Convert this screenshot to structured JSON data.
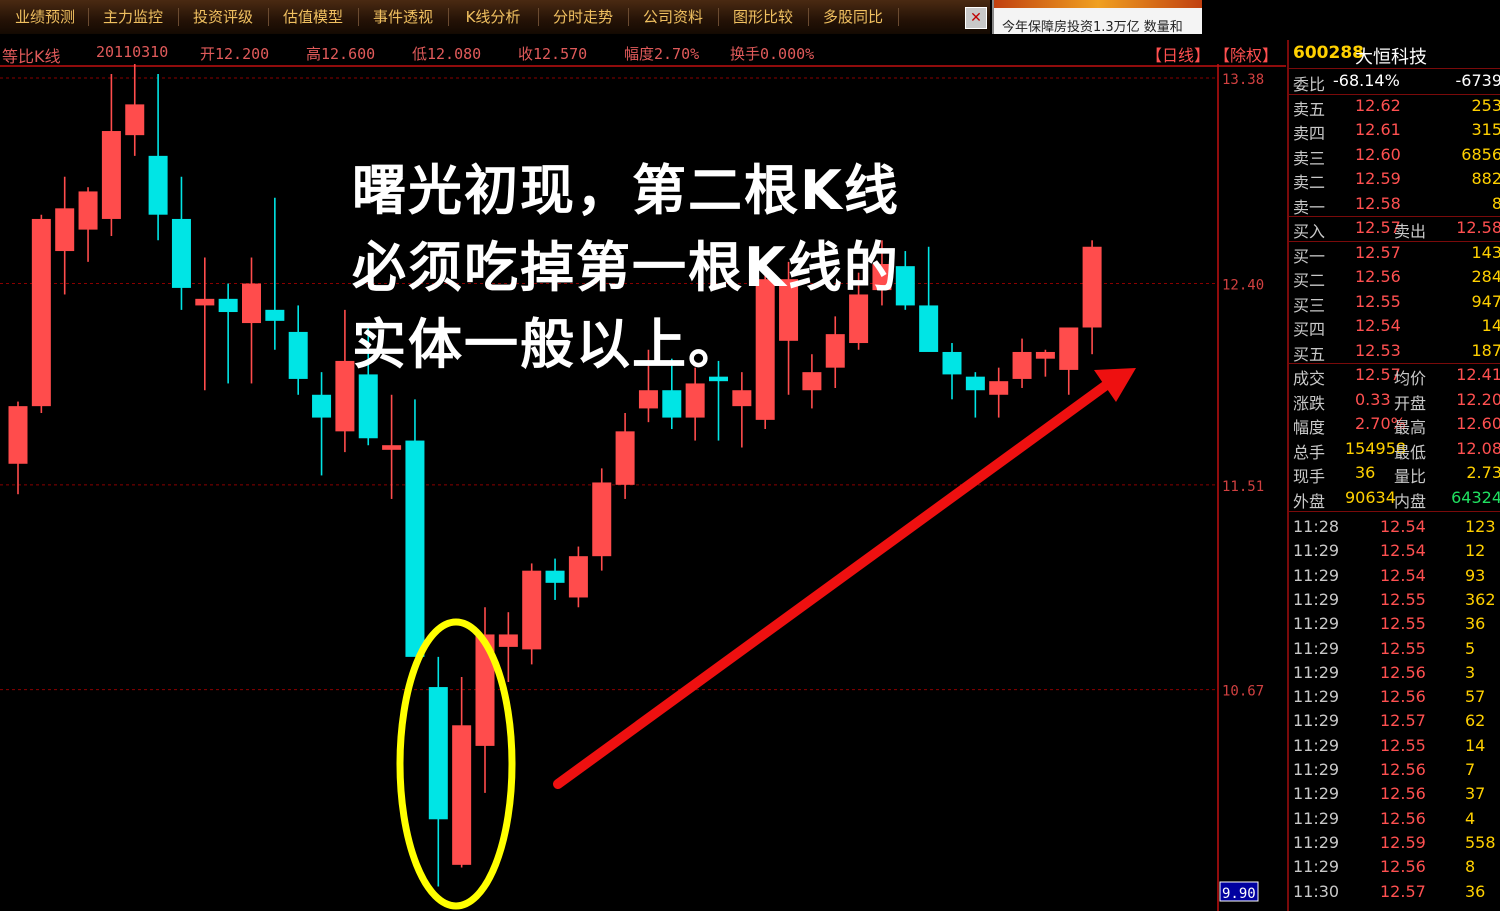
{
  "tabs": [
    "业绩预测",
    "主力监控",
    "投资评级",
    "估值模型",
    "事件透视",
    "K线分析",
    "分时走势",
    "公司资料",
    "图形比较",
    "多股同比"
  ],
  "close_icon": "close-icon",
  "ad_text": "今年保障房投资1.3万亿 数量和",
  "info": {
    "chart_name": "等比K线",
    "date": "20110310",
    "open": "开12.200",
    "high": "高12.600",
    "low": "低12.080",
    "close": "收12.570",
    "amplitude": "幅度2.70%",
    "turnover": "换手0.000%",
    "period_btn": "【日线】",
    "adjust_btn": "【除权】"
  },
  "note": {
    "line1": "曙光初现，第二根K线",
    "line2": "必须吃掉第一根K线的",
    "line3": "实体一般以上。"
  },
  "chart_data": {
    "type": "candlestick",
    "y_scale": "log",
    "y_ticks": [
      "13.38",
      "12.40",
      "11.51",
      "10.67",
      "9.90"
    ],
    "y_range": [
      9.9,
      13.38
    ],
    "candles": [
      {
        "o": 11.6,
        "h": 11.87,
        "l": 11.47,
        "c": 11.85
      },
      {
        "o": 11.85,
        "h": 12.72,
        "l": 11.82,
        "c": 12.7
      },
      {
        "o": 12.55,
        "h": 12.9,
        "l": 12.35,
        "c": 12.75
      },
      {
        "o": 12.65,
        "h": 12.85,
        "l": 12.5,
        "c": 12.83
      },
      {
        "o": 12.7,
        "h": 13.4,
        "l": 12.62,
        "c": 13.12
      },
      {
        "o": 13.1,
        "h": 13.55,
        "l": 13.0,
        "c": 13.25
      },
      {
        "o": 13.0,
        "h": 13.4,
        "l": 12.6,
        "c": 12.72
      },
      {
        "o": 12.7,
        "h": 12.9,
        "l": 12.28,
        "c": 12.38
      },
      {
        "o": 12.3,
        "h": 12.52,
        "l": 11.92,
        "c": 12.33
      },
      {
        "o": 12.33,
        "h": 12.4,
        "l": 11.95,
        "c": 12.27
      },
      {
        "o": 12.22,
        "h": 12.52,
        "l": 11.95,
        "c": 12.4
      },
      {
        "o": 12.28,
        "h": 12.8,
        "l": 12.1,
        "c": 12.23
      },
      {
        "o": 12.18,
        "h": 12.3,
        "l": 11.9,
        "c": 11.97
      },
      {
        "o": 11.9,
        "h": 12.0,
        "l": 11.55,
        "c": 11.8
      },
      {
        "o": 11.74,
        "h": 12.28,
        "l": 11.65,
        "c": 12.05
      },
      {
        "o": 11.99,
        "h": 12.2,
        "l": 11.68,
        "c": 11.71
      },
      {
        "o": 11.66,
        "h": 11.9,
        "l": 11.45,
        "c": 11.68
      },
      {
        "o": 11.7,
        "h": 11.88,
        "l": 11.1,
        "c": 10.8
      },
      {
        "o": 10.68,
        "h": 10.8,
        "l": 9.92,
        "c": 10.17
      },
      {
        "o": 10.0,
        "h": 10.72,
        "l": 9.99,
        "c": 10.53
      },
      {
        "o": 10.45,
        "h": 11.0,
        "l": 10.27,
        "c": 10.89
      },
      {
        "o": 10.84,
        "h": 10.98,
        "l": 10.7,
        "c": 10.89
      },
      {
        "o": 10.83,
        "h": 11.18,
        "l": 10.77,
        "c": 11.15
      },
      {
        "o": 11.15,
        "h": 11.2,
        "l": 11.03,
        "c": 11.1
      },
      {
        "o": 11.04,
        "h": 11.25,
        "l": 11.0,
        "c": 11.21
      },
      {
        "o": 11.21,
        "h": 11.58,
        "l": 11.15,
        "c": 11.52
      },
      {
        "o": 11.51,
        "h": 11.82,
        "l": 11.45,
        "c": 11.74
      },
      {
        "o": 11.84,
        "h": 12.1,
        "l": 11.78,
        "c": 11.92
      },
      {
        "o": 11.92,
        "h": 12.06,
        "l": 11.75,
        "c": 11.8
      },
      {
        "o": 11.8,
        "h": 12.02,
        "l": 11.7,
        "c": 11.95
      },
      {
        "o": 11.98,
        "h": 12.05,
        "l": 11.7,
        "c": 11.96
      },
      {
        "o": 11.85,
        "h": 12.0,
        "l": 11.67,
        "c": 11.92
      },
      {
        "o": 11.79,
        "h": 12.48,
        "l": 11.75,
        "c": 12.42
      },
      {
        "o": 12.14,
        "h": 12.5,
        "l": 11.9,
        "c": 12.42
      },
      {
        "o": 11.92,
        "h": 12.08,
        "l": 11.84,
        "c": 12.0
      },
      {
        "o": 12.02,
        "h": 12.25,
        "l": 11.93,
        "c": 12.17
      },
      {
        "o": 12.13,
        "h": 12.45,
        "l": 12.1,
        "c": 12.35
      },
      {
        "o": 12.37,
        "h": 12.6,
        "l": 12.3,
        "c": 12.49
      },
      {
        "o": 12.48,
        "h": 12.55,
        "l": 12.28,
        "c": 12.3
      },
      {
        "o": 12.3,
        "h": 12.57,
        "l": 12.2,
        "c": 12.09
      },
      {
        "o": 12.09,
        "h": 12.13,
        "l": 11.88,
        "c": 11.99
      },
      {
        "o": 11.98,
        "h": 12.0,
        "l": 11.8,
        "c": 11.92
      },
      {
        "o": 11.9,
        "h": 12.02,
        "l": 11.8,
        "c": 11.96
      },
      {
        "o": 11.97,
        "h": 12.15,
        "l": 11.93,
        "c": 12.09
      },
      {
        "o": 12.06,
        "h": 12.1,
        "l": 11.98,
        "c": 12.09
      },
      {
        "o": 12.01,
        "h": 12.2,
        "l": 11.9,
        "c": 12.2
      },
      {
        "o": 12.2,
        "h": 12.6,
        "l": 12.08,
        "c": 12.57
      }
    ],
    "colors": {
      "up": "#ff4c4c",
      "down": "#00e5e5",
      "grid": "#8a0000",
      "axis": "#c01010"
    },
    "annotations": [
      "yellow ellipse around candles 19-20",
      "red arrow pointing up-right"
    ]
  },
  "panel": {
    "code": "600288",
    "name": "大恒科技",
    "weibi": {
      "label": "委比",
      "pct": "-68.14%",
      "vol": "-6739"
    },
    "asks": [
      {
        "label": "卖五",
        "price": "12.62",
        "vol": "253"
      },
      {
        "label": "卖四",
        "price": "12.61",
        "vol": "315"
      },
      {
        "label": "卖三",
        "price": "12.60",
        "vol": "6856"
      },
      {
        "label": "卖二",
        "price": "12.59",
        "vol": "882"
      },
      {
        "label": "卖一",
        "price": "12.58",
        "vol": "8"
      }
    ],
    "trade": {
      "buy_label": "买入",
      "buy_price": "12.57",
      "sell_label": "卖出",
      "sell_price": "12.58"
    },
    "bids": [
      {
        "label": "买一",
        "price": "12.57",
        "vol": "143"
      },
      {
        "label": "买二",
        "price": "12.56",
        "vol": "284"
      },
      {
        "label": "买三",
        "price": "12.55",
        "vol": "947"
      },
      {
        "label": "买四",
        "price": "12.54",
        "vol": "14"
      },
      {
        "label": "买五",
        "price": "12.53",
        "vol": "187"
      }
    ],
    "stats": [
      {
        "l1": "成交",
        "v1": "12.57",
        "l2": "均价",
        "v2": "12.41"
      },
      {
        "l1": "涨跌",
        "v1": "0.33",
        "l2": "开盘",
        "v2": "12.20"
      },
      {
        "l1": "幅度",
        "v1": "2.70%",
        "l2": "最高",
        "v2": "12.60"
      },
      {
        "l1": "总手",
        "v1": "154958",
        "l2": "最低",
        "v2": "12.08"
      },
      {
        "l1": "现手",
        "v1": "36",
        "l2": "量比",
        "v2": "2.73"
      },
      {
        "l1": "外盘",
        "v1": "90634",
        "l2": "内盘",
        "v2": "64324"
      }
    ],
    "ticks": [
      {
        "t": "11:28",
        "p": "12.54",
        "v": "123"
      },
      {
        "t": "11:29",
        "p": "12.54",
        "v": "12"
      },
      {
        "t": "11:29",
        "p": "12.54",
        "v": "93"
      },
      {
        "t": "11:29",
        "p": "12.55",
        "v": "362"
      },
      {
        "t": "11:29",
        "p": "12.55",
        "v": "36"
      },
      {
        "t": "11:29",
        "p": "12.55",
        "v": "5"
      },
      {
        "t": "11:29",
        "p": "12.56",
        "v": "3"
      },
      {
        "t": "11:29",
        "p": "12.56",
        "v": "57"
      },
      {
        "t": "11:29",
        "p": "12.57",
        "v": "62"
      },
      {
        "t": "11:29",
        "p": "12.55",
        "v": "14"
      },
      {
        "t": "11:29",
        "p": "12.56",
        "v": "7"
      },
      {
        "t": "11:29",
        "p": "12.56",
        "v": "37"
      },
      {
        "t": "11:29",
        "p": "12.56",
        "v": "4"
      },
      {
        "t": "11:29",
        "p": "12.59",
        "v": "558"
      },
      {
        "t": "11:29",
        "p": "12.56",
        "v": "8"
      },
      {
        "t": "11:30",
        "p": "12.57",
        "v": "36"
      }
    ]
  }
}
